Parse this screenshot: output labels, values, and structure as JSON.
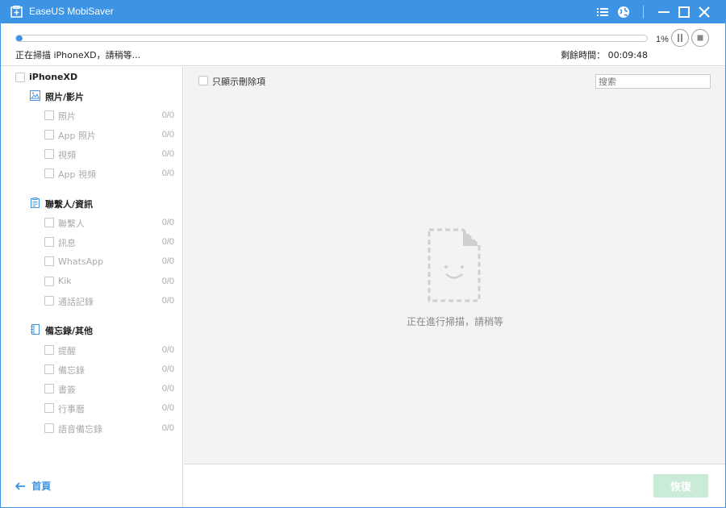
{
  "window": {
    "title": "EaseUS MobiSaver",
    "accent_color": "#3d93e4",
    "icons": [
      "menu-icon",
      "globe-icon",
      "minimize-icon",
      "maximize-icon",
      "close-icon"
    ]
  },
  "progress": {
    "percent": 1,
    "percent_label": "1%",
    "status_text": "正在掃描 iPhoneXD，請稍等...",
    "remaining_text": "剩餘時間： 00:09:48"
  },
  "sidebar": {
    "device": "iPhoneXD",
    "categories": [
      {
        "label": "照片/影片",
        "icon": "image-icon",
        "items": [
          {
            "label": "照片",
            "count": "0/0"
          },
          {
            "label": "App 照片",
            "count": "0/0"
          },
          {
            "label": "視頻",
            "count": "0/0"
          },
          {
            "label": "App 視頻",
            "count": "0/0"
          }
        ]
      },
      {
        "label": "聯繫人/資訊",
        "icon": "contacts-icon",
        "items": [
          {
            "label": "聯繫人",
            "count": "0/0"
          },
          {
            "label": "訊息",
            "count": "0/0"
          },
          {
            "label": "WhatsApp",
            "count": "0/0"
          },
          {
            "label": "Kik",
            "count": "0/0"
          },
          {
            "label": "通話記錄",
            "count": "0/0"
          }
        ]
      },
      {
        "label": "備忘錄/其他",
        "icon": "notebook-icon",
        "items": [
          {
            "label": "提醒",
            "count": "0/0"
          },
          {
            "label": "備忘錄",
            "count": "0/0"
          },
          {
            "label": "書簽",
            "count": "0/0"
          },
          {
            "label": "行事曆",
            "count": "0/0"
          },
          {
            "label": "語音備忘錄",
            "count": "0/0"
          }
        ]
      }
    ],
    "home_label": "首頁"
  },
  "main": {
    "filter_label": "只顯示刪除項",
    "search_placeholder": "搜索",
    "empty_text": "正在進行掃描，請稍等",
    "empty_icon": "empty-file-icon"
  },
  "footer": {
    "recover_label": "恢復"
  }
}
